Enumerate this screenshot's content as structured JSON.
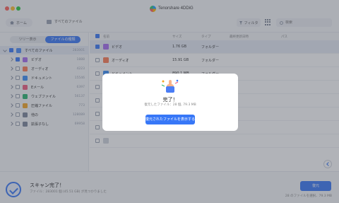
{
  "app": {
    "title": "Tenorshare 4DDiG"
  },
  "toolbar": {
    "home_label": "ホーム",
    "breadcrumb": "すべてのファイル",
    "filter_label": "フィルタ",
    "search_placeholder": "検索"
  },
  "sidebar": {
    "tabs": [
      "ツリー表示",
      "ファイルの種類"
    ],
    "active_tab": 1,
    "items": [
      {
        "label": "すべてのファイル",
        "count": "283001",
        "color": "#4a8cf7"
      },
      {
        "label": "ビデオ",
        "count": "1888",
        "color": "#a66cf0"
      },
      {
        "label": "オーディオ",
        "count": "4223",
        "color": "#ff7b52"
      },
      {
        "label": "ドキュメント",
        "count": "15546",
        "color": "#3a8ef6"
      },
      {
        "label": "Eメール",
        "count": "6397",
        "color": "#f05a7e"
      },
      {
        "label": "ウェブファイル",
        "count": "56137",
        "color": "#26b66e"
      },
      {
        "label": "圧縮ファイル",
        "count": "773",
        "color": "#f5a623"
      },
      {
        "label": "他の",
        "count": "128089",
        "color": "#7a8599"
      },
      {
        "label": "拡張子なし",
        "count": "69958",
        "color": "#7a8599"
      }
    ]
  },
  "table": {
    "headers": [
      "名前",
      "サイズ",
      "タイプ",
      "最終更新日時",
      "パス"
    ],
    "rows": [
      {
        "name": "ビデオ",
        "size": "1.76 GB",
        "type": "フォルダー",
        "color": "#a66cf0",
        "selected": true
      },
      {
        "name": "オーディオ",
        "size": "15.91 GB",
        "type": "フォルダー",
        "color": "#ff7b52",
        "selected": false
      },
      {
        "name": "ドキュメント",
        "size": "890.1 MB",
        "type": "フォルダー",
        "color": "#3a8ef6",
        "selected": false
      },
      {
        "name": "",
        "size": "",
        "type": "",
        "color": "#cfd4dd",
        "selected": false
      },
      {
        "name": "",
        "size": "",
        "type": "",
        "color": "#cfd4dd",
        "selected": false
      },
      {
        "name": "",
        "size": "",
        "type": "",
        "color": "#cfd4dd",
        "selected": false
      },
      {
        "name": "",
        "size": "",
        "type": "",
        "color": "#cfd4dd",
        "selected": false
      },
      {
        "name": "",
        "size": "",
        "type": "",
        "color": "#cfd4dd",
        "selected": false
      }
    ]
  },
  "modal": {
    "title": "完了！",
    "info": "復元したファイル：28 個, 79.3 MB",
    "button_label": "復元されたファイルを表示する"
  },
  "status": {
    "title": "スキャン完了！",
    "subtitle": "ファイル：283001 個 (45.51 GB) が見つかりました",
    "restore_label": "復元",
    "selection_info": "28 のファイルを選択、79.3 MB"
  },
  "colors": {
    "accent": "#3777f7"
  }
}
